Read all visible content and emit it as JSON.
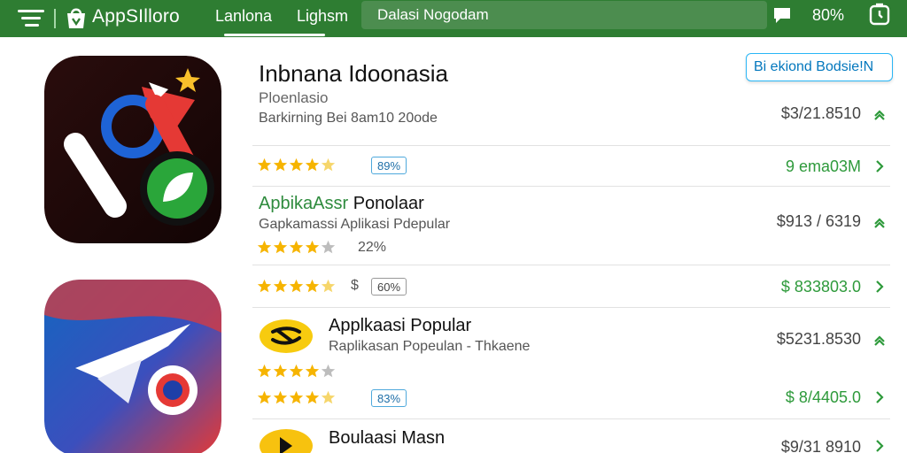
{
  "header": {
    "logo_text": "AppSIlloro",
    "tabs": [
      {
        "label": "Lanlona"
      },
      {
        "label": "Lighsm"
      }
    ],
    "search_text": "Dalasi Nogodam",
    "status_text": "80%",
    "colors": {
      "bar": "#2e7d32",
      "search": "#4c8d4f"
    }
  },
  "hero": {
    "title": "Inbnana Idoonasia",
    "subtitle": "Ploenlasio",
    "description": "Barkirning Bei 8am10 20ode",
    "action_label": "Bi ekiond Bodsie!N",
    "price": "$3/21.8510"
  },
  "rows": [
    {
      "rating": 4.5,
      "badge": "89%",
      "price": "9 ema03M"
    },
    {
      "title_accent": "ApbikaAssr",
      "title_rest": "Ponolaar",
      "subtitle": "Gapkamassi   Aplikasi Pdepular",
      "price": "$913 / 6319",
      "rating": 4,
      "pct": "22%"
    },
    {
      "rating": 4.5,
      "rating_suffix": "$",
      "badge": "60%",
      "price": "$ 833803.0"
    },
    {
      "title": "Applkaasi Popular",
      "subtitle": "Raplikasan Popeulan -  Thkaene",
      "price": "$5231.8530",
      "rating": 4
    },
    {
      "rating": 4.5,
      "badge": "83%",
      "price": "$ 8/4405.0"
    },
    {
      "title": "Boulaasi Masn",
      "price": "$9/31 8910"
    }
  ],
  "icons": {
    "menu": "menu-icon",
    "logo": "shopping-bag-icon",
    "chat": "chat-bubble-icon",
    "clock": "clock-icon",
    "chevron": "chevron-right-icon",
    "star": "star-icon"
  },
  "accent_colors": {
    "green": "#2e9a3b",
    "star": "#f6b400",
    "badge_border": "#4fa9dc"
  }
}
